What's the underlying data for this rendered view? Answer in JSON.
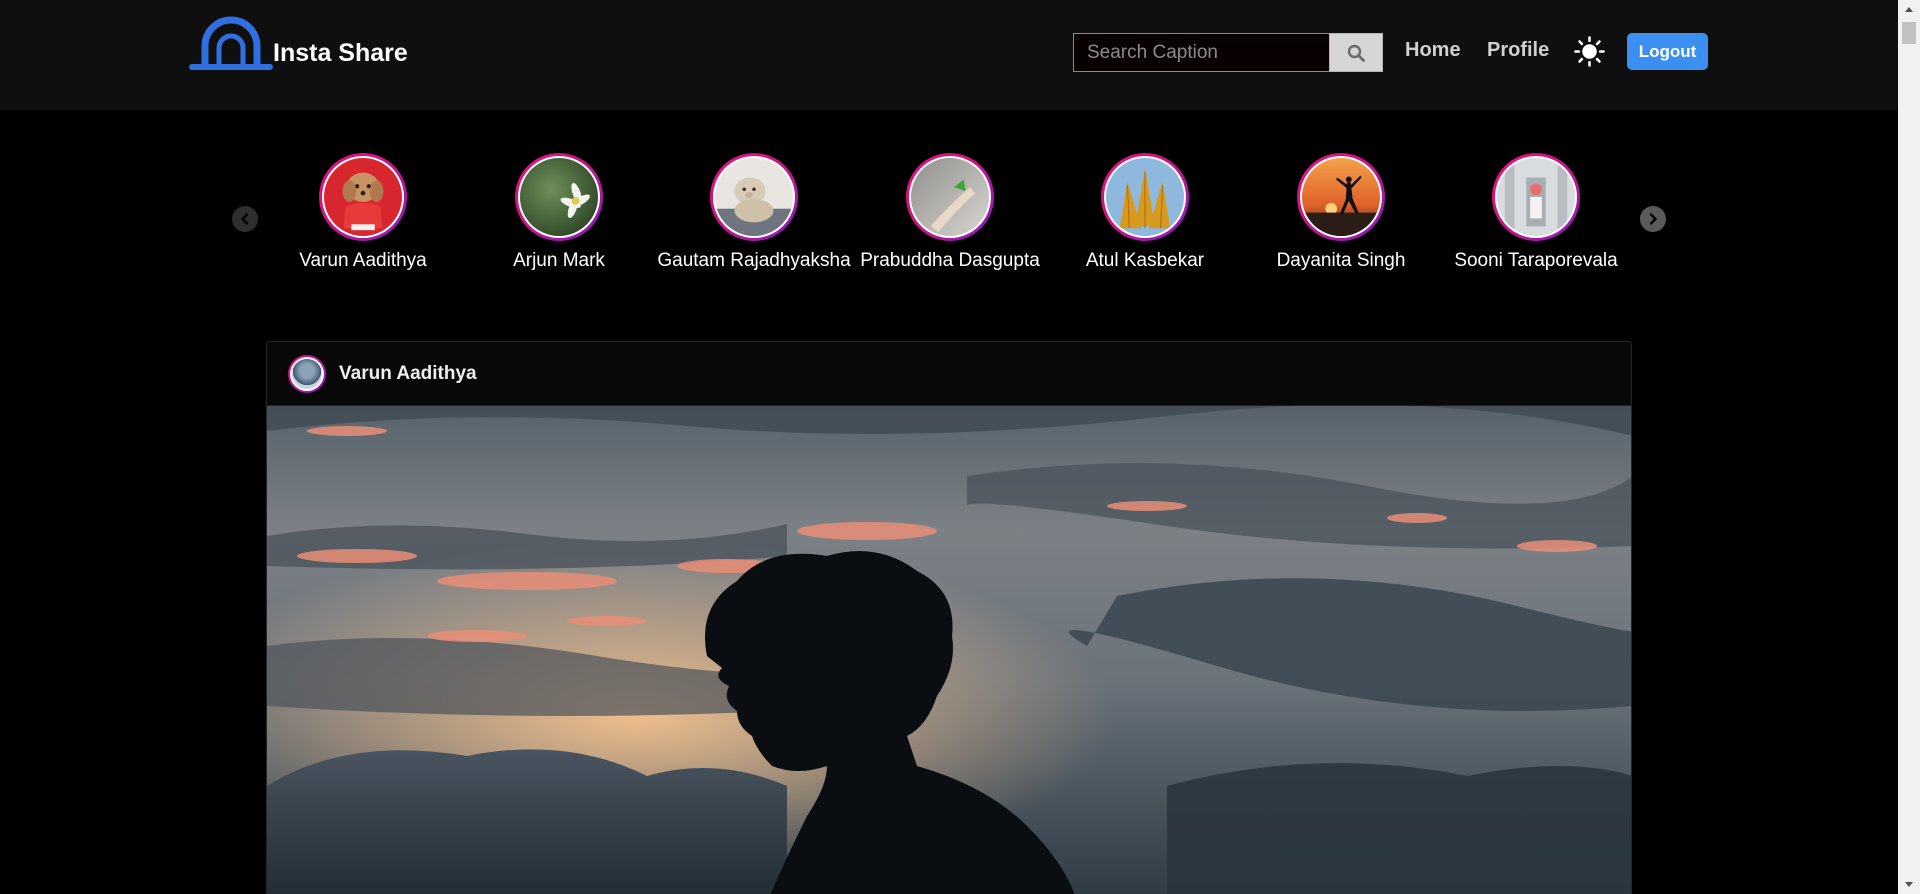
{
  "header": {
    "brand": "Insta Share",
    "search": {
      "placeholder": "Search Caption",
      "value": ""
    },
    "nav": {
      "home": "Home",
      "profile": "Profile"
    },
    "logout": "Logout"
  },
  "stories": [
    {
      "name": "Varun Aadithya"
    },
    {
      "name": "Arjun Mark"
    },
    {
      "name": "Gautam Rajadhyaksha"
    },
    {
      "name": "Prabuddha Dasgupta"
    },
    {
      "name": "Atul Kasbekar"
    },
    {
      "name": "Dayanita Singh"
    },
    {
      "name": "Sooni Taraporevala"
    }
  ],
  "post": {
    "username": "Varun Aadithya"
  },
  "icons": {
    "logo": "insta-share-logo",
    "search": "search-icon",
    "theme": "sun-icon",
    "prev": "chevron-left-icon",
    "next": "chevron-right-icon"
  },
  "colors": {
    "header_bg": "#0f0f0f",
    "page_bg": "#000000",
    "accent": "#3b8ff0",
    "story_ring_start": "#e8117a",
    "story_ring_end": "#8a1ac8"
  }
}
